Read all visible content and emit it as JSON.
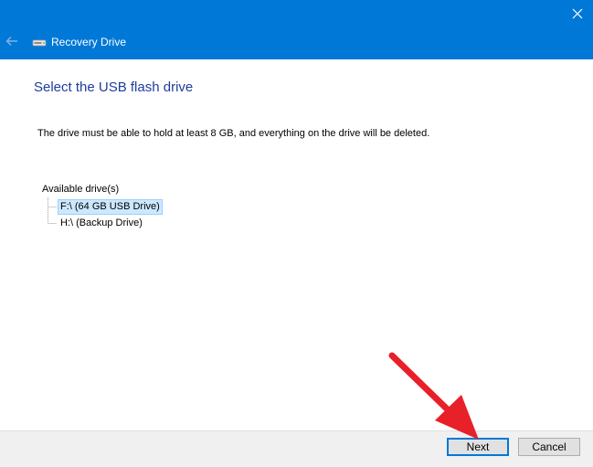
{
  "window": {
    "title": "Recovery Drive"
  },
  "page": {
    "heading": "Select the USB flash drive",
    "description": "The drive must be able to hold at least 8 GB, and everything on the drive will be deleted."
  },
  "drives": {
    "root_label": "Available drive(s)",
    "items": [
      {
        "label": "F:\\ (64 GB USB Drive)",
        "selected": true
      },
      {
        "label": "H:\\ (Backup Drive)",
        "selected": false
      }
    ]
  },
  "footer": {
    "next_label": "Next",
    "cancel_label": "Cancel"
  },
  "colors": {
    "titlebar": "#0078d7",
    "heading": "#1f3d9e",
    "selection": "#cce8ff",
    "annotation_arrow": "#e8202a"
  },
  "icons": {
    "close": "close-icon",
    "back": "back-arrow-icon",
    "app": "drive-icon"
  }
}
